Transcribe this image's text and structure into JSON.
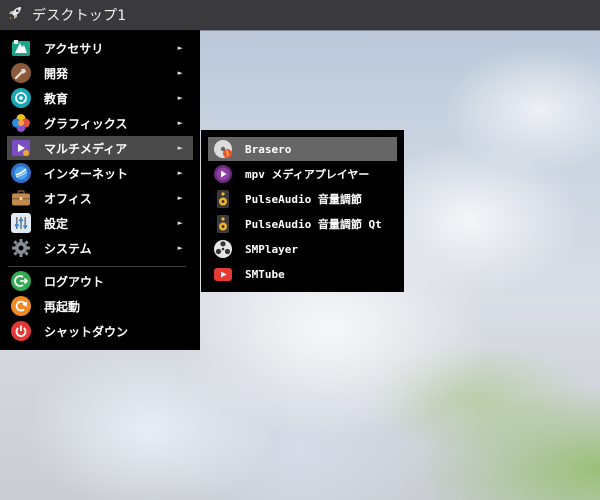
{
  "panel": {
    "title": "デスクトップ1",
    "launcher_icon": "rocket-icon"
  },
  "menu": {
    "items": [
      {
        "label": "アクセサリ",
        "icon": "accessories-icon",
        "color": "#1aa48c",
        "submenu": true
      },
      {
        "label": "開発",
        "icon": "development-icon",
        "color": "#8b5a3c",
        "submenu": true
      },
      {
        "label": "教育",
        "icon": "education-icon",
        "color": "#19a7b5",
        "submenu": true
      },
      {
        "label": "グラフィックス",
        "icon": "graphics-icon",
        "color": "#e8742c",
        "submenu": true
      },
      {
        "label": "マルチメディア",
        "icon": "multimedia-icon",
        "color": "#7b4fc4",
        "submenu": true,
        "active": true
      },
      {
        "label": "インターネット",
        "icon": "internet-icon",
        "color": "#2f6fc9",
        "submenu": true
      },
      {
        "label": "オフィス",
        "icon": "office-icon",
        "color": "#b07a42",
        "submenu": true
      },
      {
        "label": "設定",
        "icon": "settings-icon",
        "color": "#dfe6ee",
        "submenu": true
      },
      {
        "label": "システム",
        "icon": "system-icon",
        "color": "#5a5f66",
        "submenu": true
      }
    ],
    "session_items": [
      {
        "label": "ログアウト",
        "icon": "logout-icon",
        "color": "#34a853"
      },
      {
        "label": "再起動",
        "icon": "restart-icon",
        "color": "#f08a24"
      },
      {
        "label": "シャットダウン",
        "icon": "shutdown-icon",
        "color": "#e53935"
      }
    ],
    "arrow_glyph": "►"
  },
  "submenu": {
    "items": [
      {
        "label": "Brasero",
        "icon": "brasero-icon",
        "active": true
      },
      {
        "label": "mpv メディアプレイヤー",
        "icon": "mpv-icon"
      },
      {
        "label": "PulseAudio 音量調節",
        "icon": "speaker-icon"
      },
      {
        "label": "PulseAudio 音量調節 Qt",
        "icon": "speaker-icon"
      },
      {
        "label": "SMPlayer",
        "icon": "smplayer-icon"
      },
      {
        "label": "SMTube",
        "icon": "smtube-icon"
      }
    ]
  }
}
